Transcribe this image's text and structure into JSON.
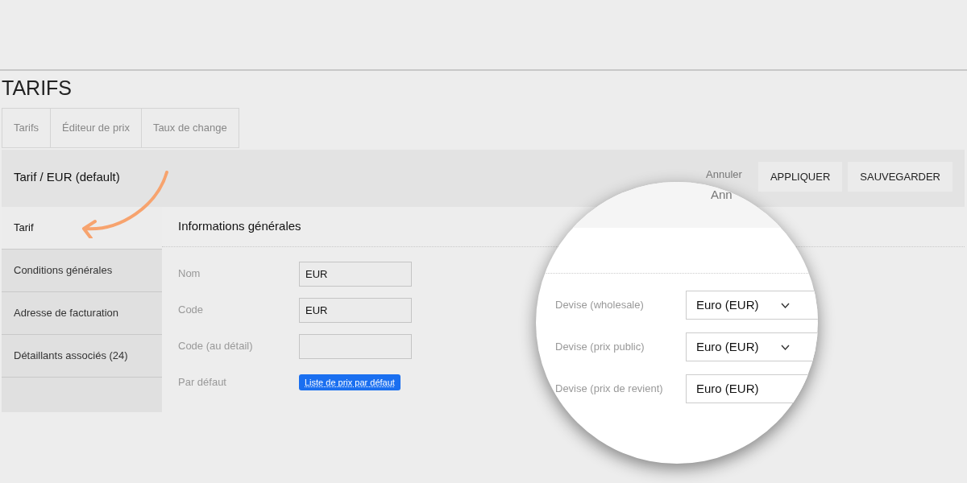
{
  "page": {
    "title": "TARIFS"
  },
  "tabs": [
    {
      "label": "Tarifs",
      "selected": false
    },
    {
      "label": "Éditeur de prix",
      "selected": false
    },
    {
      "label": "Taux de change",
      "selected": false
    }
  ],
  "header": {
    "title": "Tarif / EUR (default)",
    "cancel": "Annuler",
    "buttons": [
      "APPLIQUER",
      "SAUVEGARDER"
    ]
  },
  "sidebar": {
    "items": [
      {
        "label": "Tarif",
        "selected": true
      },
      {
        "label": "Conditions générales",
        "selected": false
      },
      {
        "label": "Adresse de facturation",
        "selected": false
      },
      {
        "label": "Détaillants associés (24)",
        "selected": false
      }
    ]
  },
  "section": {
    "title": "Informations générales",
    "fields": [
      {
        "label": "Nom",
        "kind": "input",
        "value": "EUR"
      },
      {
        "label": "Code",
        "kind": "input",
        "value": "EUR"
      },
      {
        "label": "Code (au détail)",
        "kind": "input"
      },
      {
        "label": "Par défaut",
        "kind": "badge",
        "value": "Liste de prix par défaut"
      }
    ]
  },
  "magnifier": {
    "peek_text": "Ann",
    "fields": [
      {
        "label": "Devise (wholesale)",
        "value": "Euro (EUR)",
        "dropdown": true
      },
      {
        "label": "Devise (prix public)",
        "value": "Euro (EUR)",
        "dropdown": true
      },
      {
        "label": "Devise (prix de revient)",
        "value": "Euro (EUR)",
        "dropdown": false
      }
    ]
  }
}
